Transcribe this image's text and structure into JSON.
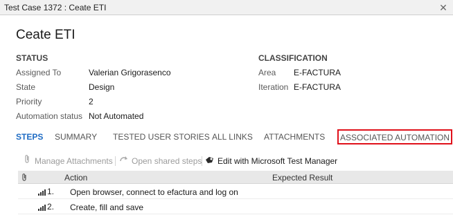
{
  "window": {
    "title": "Test Case 1372 : Ceate ETI"
  },
  "work_item": {
    "title": "Ceate ETI"
  },
  "status": {
    "heading": "STATUS",
    "fields": [
      {
        "label": "Assigned To",
        "value": "Valerian Grigorasenco"
      },
      {
        "label": "State",
        "value": "Design"
      },
      {
        "label": "Priority",
        "value": "2"
      },
      {
        "label": "Automation status",
        "value": "Not Automated"
      }
    ]
  },
  "classification": {
    "heading": "CLASSIFICATION",
    "fields": [
      {
        "label": "Area",
        "value": "E-FACTURA"
      },
      {
        "label": "Iteration",
        "value": "E-FACTURA"
      }
    ]
  },
  "tabs": [
    {
      "label": "STEPS",
      "active": true
    },
    {
      "label": "SUMMARY"
    },
    {
      "label": "TESTED USER STORIES"
    },
    {
      "label": "ALL LINKS"
    },
    {
      "label": "ATTACHMENTS"
    },
    {
      "label": "ASSOCIATED AUTOMATION",
      "highlighted": true
    }
  ],
  "toolbar": {
    "manage_attachments": "Manage Attachments",
    "open_shared_steps": "Open shared steps",
    "edit_mtm": "Edit with Microsoft Test Manager"
  },
  "steps_grid": {
    "columns": {
      "action": "Action",
      "expected": "Expected Result"
    },
    "rows": [
      {
        "num": "1.",
        "action": "Open browser, connect to efactura and log on",
        "expected": ""
      },
      {
        "num": "2.",
        "action": "Create, fill and save",
        "expected": ""
      }
    ]
  },
  "colors": {
    "active_tab": "#1f6cc4",
    "highlight_border": "#e0101a"
  },
  "icons": [
    "close-icon",
    "paperclip-icon",
    "shared-steps-icon",
    "mtm-icon",
    "step-bars-icon"
  ]
}
